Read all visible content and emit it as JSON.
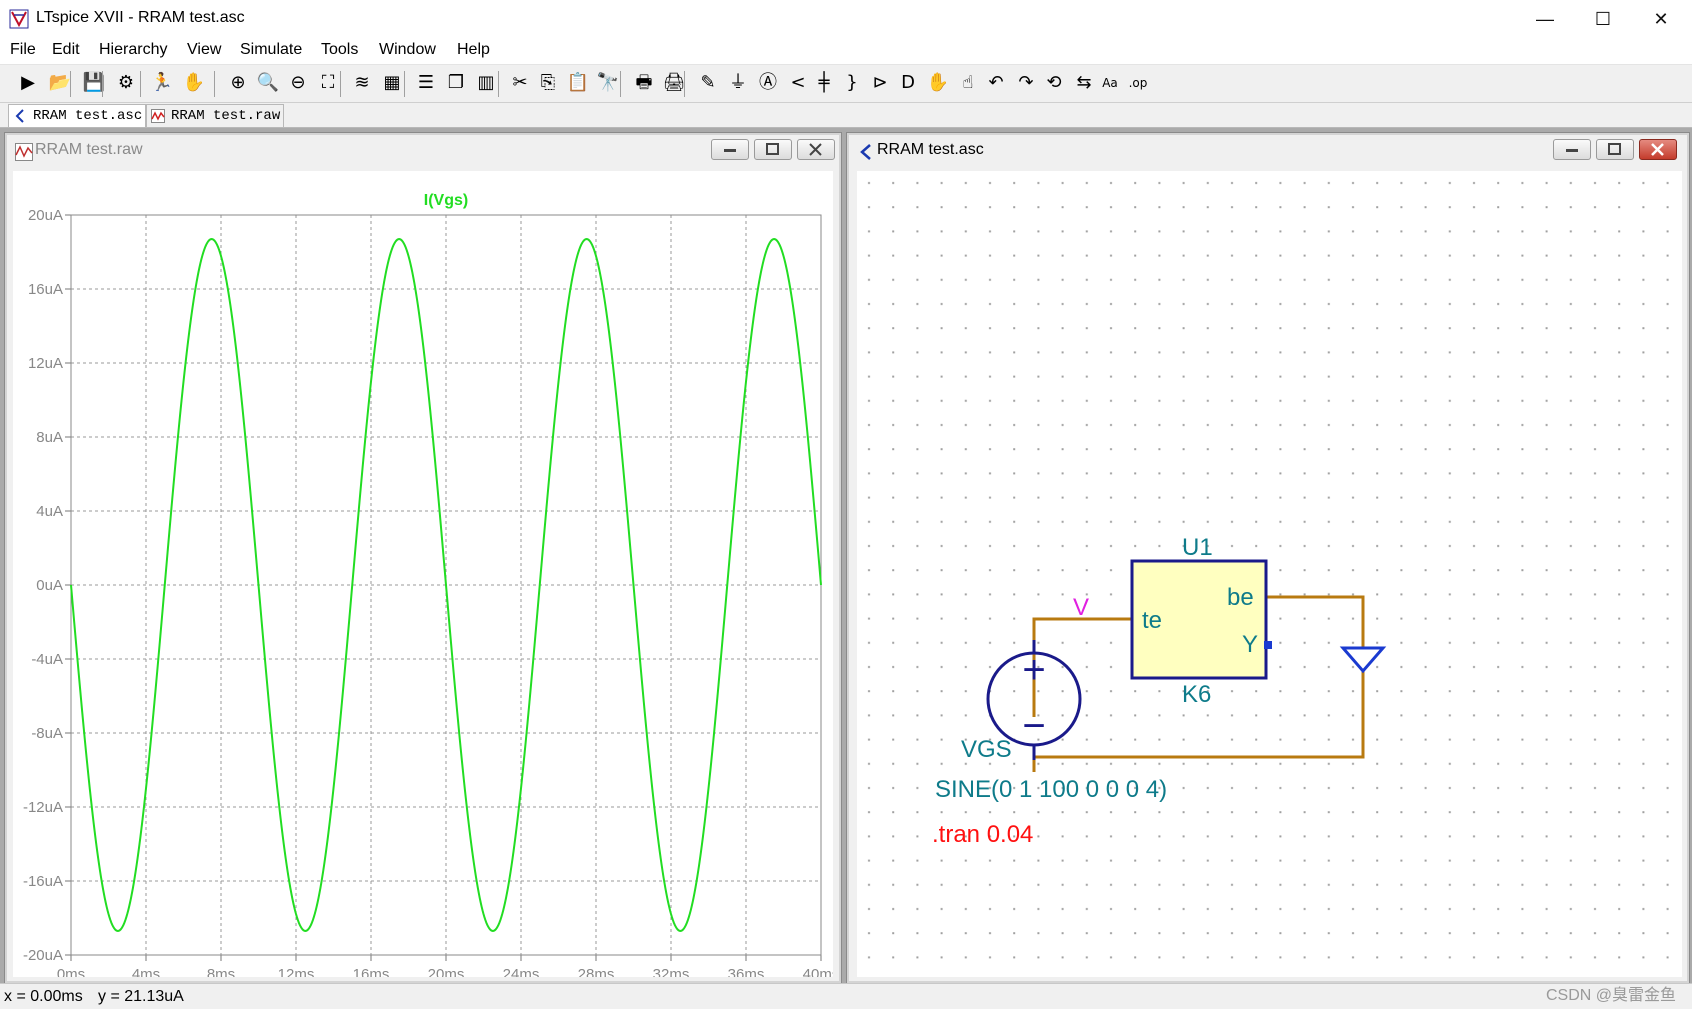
{
  "window": {
    "title": "LTspice XVII - RRAM test.asc",
    "controls": {
      "minimize": "—",
      "maximize": "☐",
      "close": "✕"
    }
  },
  "menu": [
    "File",
    "Edit",
    "Hierarchy",
    "View",
    "Simulate",
    "Tools",
    "Window",
    "Help"
  ],
  "toolbar_icons": [
    "new-schematic-icon",
    "open-icon",
    "save-icon",
    "control-panel-icon",
    "run-icon",
    "halt-icon",
    "zoom-in-icon",
    "zoom-pan-icon",
    "zoom-out-icon",
    "zoom-fit-icon",
    "autorange-icon",
    "grid-icon",
    "tile-horizontal-icon",
    "cascade-icon",
    "tile-vertical-icon",
    "cut-icon",
    "copy-icon",
    "paste-icon",
    "find-icon",
    "print-icon",
    "print-setup-icon",
    "draw-wire-icon",
    "ground-icon",
    "label-net-icon",
    "resistor-icon",
    "capacitor-icon",
    "inductor-icon",
    "diode-icon",
    "component-icon",
    "move-icon",
    "drag-icon",
    "undo-icon",
    "redo-icon",
    "rotate-icon",
    "mirror-icon",
    "text-icon",
    "spice-directive-icon"
  ],
  "tabs": [
    {
      "label": "RRAM test.asc",
      "icon": "schematic-icon"
    },
    {
      "label": "RRAM test.raw",
      "icon": "waveform-icon"
    }
  ],
  "waveform_window": {
    "title": "RRAM test.raw",
    "chart_data": {
      "type": "line",
      "title": "I(Vgs)",
      "x_ticks": [
        "0ms",
        "4ms",
        "8ms",
        "12ms",
        "16ms",
        "20ms",
        "24ms",
        "28ms",
        "32ms",
        "36ms",
        "40ms"
      ],
      "y_ticks": [
        "20uA",
        "16uA",
        "12uA",
        "8uA",
        "4uA",
        "0uA",
        "-4uA",
        "-8uA",
        "-12uA",
        "-16uA",
        "-20uA"
      ],
      "xlim_ms": [
        0,
        40
      ],
      "ylim_uA": [
        -20,
        20
      ],
      "grid": true,
      "series": [
        {
          "name": "I(Vgs)",
          "color": "#22dd22",
          "function": "sine",
          "amplitude_uA": 18.7,
          "frequency_hz": 100,
          "phase_sign": -1,
          "x_start_ms": 0,
          "x_end_ms": 40
        }
      ]
    }
  },
  "schematic_window": {
    "title": "RRAM test.asc",
    "component": {
      "ref": "U1",
      "model": "K6",
      "pins": [
        "te",
        "be",
        "Y"
      ]
    },
    "source": {
      "ref": "VGS",
      "value": "SINE(0 1 100 0 0 0 4)",
      "plus": "+",
      "minus": "−"
    },
    "net_label": "V",
    "directive": ".tran 0.04"
  },
  "status": {
    "x": "x = 0.00ms",
    "y": "y = 21.13uA"
  },
  "watermark": "CSDN @臭雷金鱼"
}
